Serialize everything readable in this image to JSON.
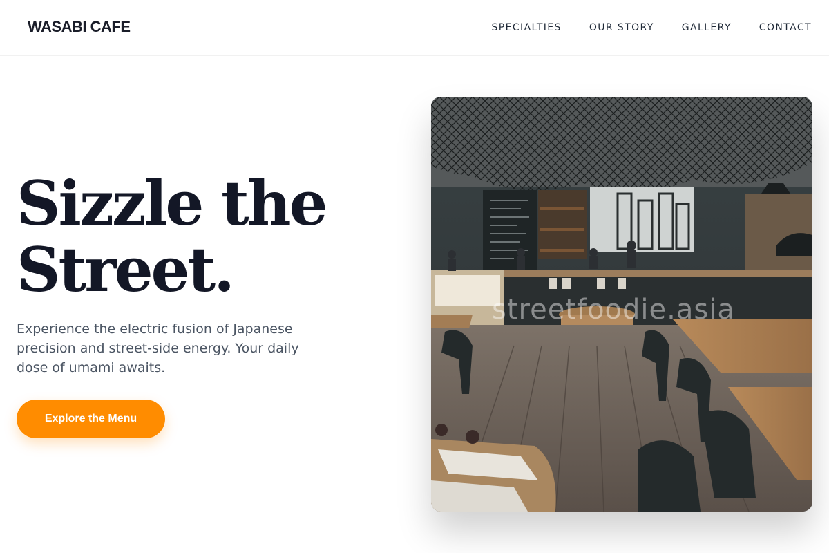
{
  "brand": "WASABI CAFE",
  "nav": {
    "items": [
      {
        "label": "SPECIALTIES"
      },
      {
        "label": "OUR STORY"
      },
      {
        "label": "GALLERY"
      },
      {
        "label": "CONTACT"
      }
    ]
  },
  "hero": {
    "title_line1": "Sizzle the",
    "title_line2": "Street.",
    "subtitle": "Experience the electric fusion of Japanese precision and street-side energy. Your daily dose of umami awaits.",
    "cta_label": "Explore the Menu"
  },
  "image": {
    "watermark": "streetfoodie.asia"
  },
  "colors": {
    "accent": "#ff8c00",
    "heading": "#131726",
    "body_text": "#4b5563"
  }
}
